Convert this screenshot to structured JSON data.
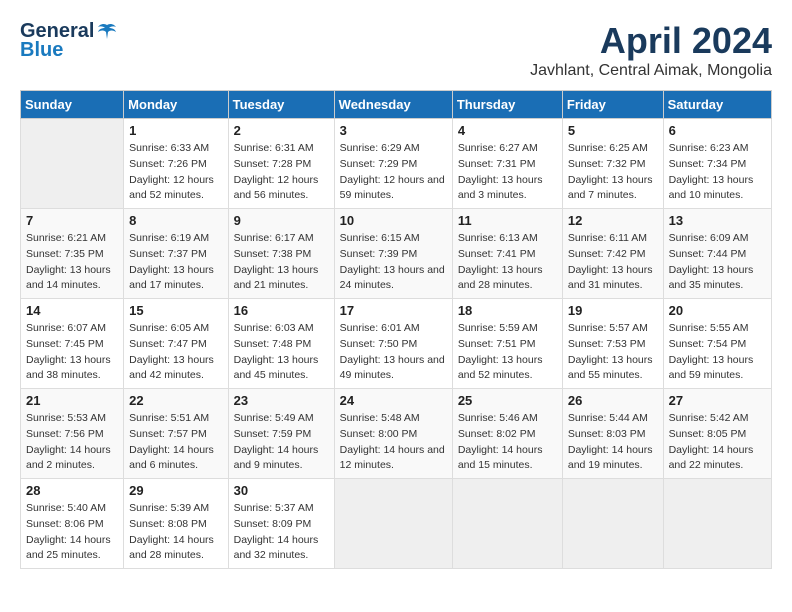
{
  "header": {
    "logo": {
      "general": "General",
      "blue": "Blue"
    },
    "title": "April 2024",
    "location": "Javhlant, Central Aimak, Mongolia"
  },
  "weekdays": [
    "Sunday",
    "Monday",
    "Tuesday",
    "Wednesday",
    "Thursday",
    "Friday",
    "Saturday"
  ],
  "weeks": [
    [
      {
        "day": "",
        "empty": true
      },
      {
        "day": "1",
        "sunrise": "6:33 AM",
        "sunset": "7:26 PM",
        "daylight": "12 hours and 52 minutes."
      },
      {
        "day": "2",
        "sunrise": "6:31 AM",
        "sunset": "7:28 PM",
        "daylight": "12 hours and 56 minutes."
      },
      {
        "day": "3",
        "sunrise": "6:29 AM",
        "sunset": "7:29 PM",
        "daylight": "12 hours and 59 minutes."
      },
      {
        "day": "4",
        "sunrise": "6:27 AM",
        "sunset": "7:31 PM",
        "daylight": "13 hours and 3 minutes."
      },
      {
        "day": "5",
        "sunrise": "6:25 AM",
        "sunset": "7:32 PM",
        "daylight": "13 hours and 7 minutes."
      },
      {
        "day": "6",
        "sunrise": "6:23 AM",
        "sunset": "7:34 PM",
        "daylight": "13 hours and 10 minutes."
      }
    ],
    [
      {
        "day": "7",
        "sunrise": "6:21 AM",
        "sunset": "7:35 PM",
        "daylight": "13 hours and 14 minutes."
      },
      {
        "day": "8",
        "sunrise": "6:19 AM",
        "sunset": "7:37 PM",
        "daylight": "13 hours and 17 minutes."
      },
      {
        "day": "9",
        "sunrise": "6:17 AM",
        "sunset": "7:38 PM",
        "daylight": "13 hours and 21 minutes."
      },
      {
        "day": "10",
        "sunrise": "6:15 AM",
        "sunset": "7:39 PM",
        "daylight": "13 hours and 24 minutes."
      },
      {
        "day": "11",
        "sunrise": "6:13 AM",
        "sunset": "7:41 PM",
        "daylight": "13 hours and 28 minutes."
      },
      {
        "day": "12",
        "sunrise": "6:11 AM",
        "sunset": "7:42 PM",
        "daylight": "13 hours and 31 minutes."
      },
      {
        "day": "13",
        "sunrise": "6:09 AM",
        "sunset": "7:44 PM",
        "daylight": "13 hours and 35 minutes."
      }
    ],
    [
      {
        "day": "14",
        "sunrise": "6:07 AM",
        "sunset": "7:45 PM",
        "daylight": "13 hours and 38 minutes."
      },
      {
        "day": "15",
        "sunrise": "6:05 AM",
        "sunset": "7:47 PM",
        "daylight": "13 hours and 42 minutes."
      },
      {
        "day": "16",
        "sunrise": "6:03 AM",
        "sunset": "7:48 PM",
        "daylight": "13 hours and 45 minutes."
      },
      {
        "day": "17",
        "sunrise": "6:01 AM",
        "sunset": "7:50 PM",
        "daylight": "13 hours and 49 minutes."
      },
      {
        "day": "18",
        "sunrise": "5:59 AM",
        "sunset": "7:51 PM",
        "daylight": "13 hours and 52 minutes."
      },
      {
        "day": "19",
        "sunrise": "5:57 AM",
        "sunset": "7:53 PM",
        "daylight": "13 hours and 55 minutes."
      },
      {
        "day": "20",
        "sunrise": "5:55 AM",
        "sunset": "7:54 PM",
        "daylight": "13 hours and 59 minutes."
      }
    ],
    [
      {
        "day": "21",
        "sunrise": "5:53 AM",
        "sunset": "7:56 PM",
        "daylight": "14 hours and 2 minutes."
      },
      {
        "day": "22",
        "sunrise": "5:51 AM",
        "sunset": "7:57 PM",
        "daylight": "14 hours and 6 minutes."
      },
      {
        "day": "23",
        "sunrise": "5:49 AM",
        "sunset": "7:59 PM",
        "daylight": "14 hours and 9 minutes."
      },
      {
        "day": "24",
        "sunrise": "5:48 AM",
        "sunset": "8:00 PM",
        "daylight": "14 hours and 12 minutes."
      },
      {
        "day": "25",
        "sunrise": "5:46 AM",
        "sunset": "8:02 PM",
        "daylight": "14 hours and 15 minutes."
      },
      {
        "day": "26",
        "sunrise": "5:44 AM",
        "sunset": "8:03 PM",
        "daylight": "14 hours and 19 minutes."
      },
      {
        "day": "27",
        "sunrise": "5:42 AM",
        "sunset": "8:05 PM",
        "daylight": "14 hours and 22 minutes."
      }
    ],
    [
      {
        "day": "28",
        "sunrise": "5:40 AM",
        "sunset": "8:06 PM",
        "daylight": "14 hours and 25 minutes."
      },
      {
        "day": "29",
        "sunrise": "5:39 AM",
        "sunset": "8:08 PM",
        "daylight": "14 hours and 28 minutes."
      },
      {
        "day": "30",
        "sunrise": "5:37 AM",
        "sunset": "8:09 PM",
        "daylight": "14 hours and 32 minutes."
      },
      {
        "day": "",
        "empty": true
      },
      {
        "day": "",
        "empty": true
      },
      {
        "day": "",
        "empty": true
      },
      {
        "day": "",
        "empty": true
      }
    ]
  ],
  "labels": {
    "sunrise_prefix": "Sunrise: ",
    "sunset_prefix": "Sunset: ",
    "daylight_prefix": "Daylight: "
  }
}
